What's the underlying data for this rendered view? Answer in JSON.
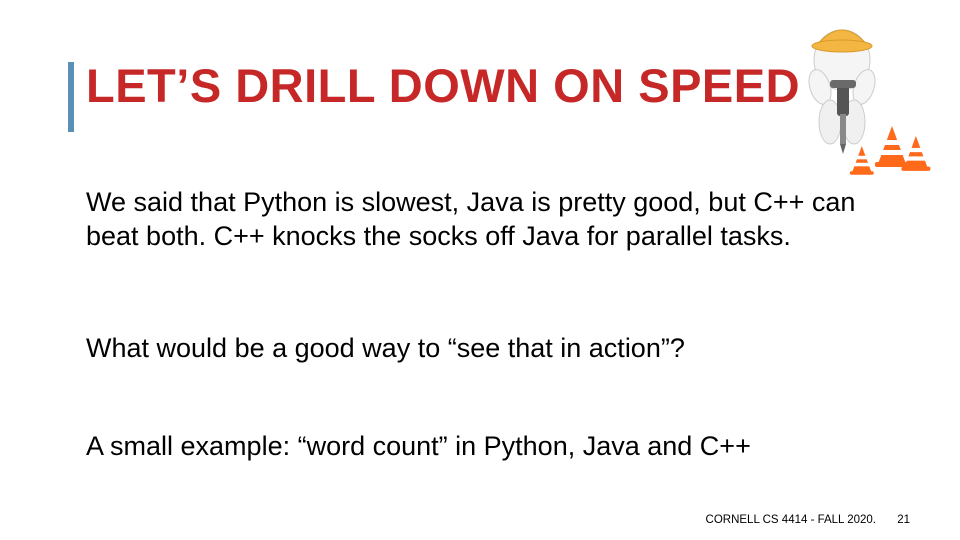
{
  "title": "LET’S DRILL DOWN ON SPEED",
  "paragraphs": {
    "p1": "We said that Python is slowest, Java is pretty good, but C++ can beat both.  C++ knocks the socks off Java for parallel tasks.",
    "p2": "What would be a good way to “see that in action”?",
    "p3": "A small example: “word count” in Python, Java and C++"
  },
  "footer": {
    "course": "CORNELL CS 4414 - FALL 2020.",
    "page": "21"
  },
  "clipart": {
    "name": "construction-worker-jackhammer-cones",
    "helmet_color": "#f4b642",
    "cone_color": "#ff6a1a",
    "cone_stripe": "#ffffff",
    "figure_color": "#f2f2f2",
    "tool_color": "#555555"
  }
}
